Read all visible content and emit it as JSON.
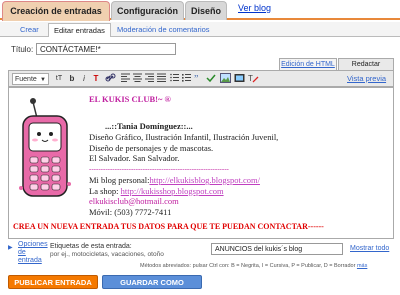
{
  "tabs": {
    "create_posts": "Creación de entradas",
    "settings": "Configuración",
    "design": "Diseño",
    "view_blog": "Ver blog"
  },
  "subtabs": {
    "create": "Crear",
    "edit_posts": "Editar entradas",
    "moderate_comments": "Moderación de comentarios"
  },
  "title_label": "Título:",
  "title_value": "CONTÁCTAME!*",
  "editor_tabs": {
    "html": "Edición de HTML",
    "compose": "Redactar"
  },
  "preview_link": "Vista previa",
  "toolbar": {
    "font_select": "Fuente",
    "size_icon": "tT",
    "bold": "b",
    "italic": "i",
    "color_icon": "T"
  },
  "post": {
    "heading": "EL KUKIS CLUB!~ ®",
    "name_line": "...::Tania Domínguez::...",
    "role1": "Diseño Gráfico, Ilustración Infantil, Ilustración Juvenil,",
    "role2": "Diseño de personajes y de mascotas.",
    "location": "El Salvador. San Salvador.",
    "separator": "------------------------------------------------------------",
    "blog_label": "Mi blog personal:",
    "blog_url": "http://elkukisblog.blogspot.com/",
    "shop_label": "La shop: ",
    "shop_url": "http://kukisshop.blogspot.com",
    "email": "elkukisclub@hotmail.com",
    "phone": "Móvil: (503) 7772-7411",
    "cta": "CREA UN NUEVA ENTRADA TUS DATOS PARA QUE TE PUEDAN CONTACTAR------"
  },
  "options": {
    "link": "Opciones de entrada",
    "labels_title": "Etiquetas de esta entrada:",
    "labels_hint": "por ej., motocicletas, vacaciones, otoño",
    "labels_value": "ANUNCIOS del kukis´s blog",
    "show_all": "Mostrar todo"
  },
  "shortcuts": "Métodos abreviados: pulsar Ctrl con: B = Negrita, I = Cursiva, P = Publicar, D = Borrador",
  "shortcuts_more": "más",
  "buttons": {
    "publish": "PUBLICAR ENTRADA",
    "save_draft": "GUARDAR COMO BORRADOR"
  },
  "colors": {
    "tab_active": "#f0d0b0",
    "accent_orange": "#e8883a",
    "publish_bg": "#f57900",
    "draft_bg": "#5b8fd9",
    "heading_pink": "#c020a0",
    "cta_red": "#e00000"
  }
}
